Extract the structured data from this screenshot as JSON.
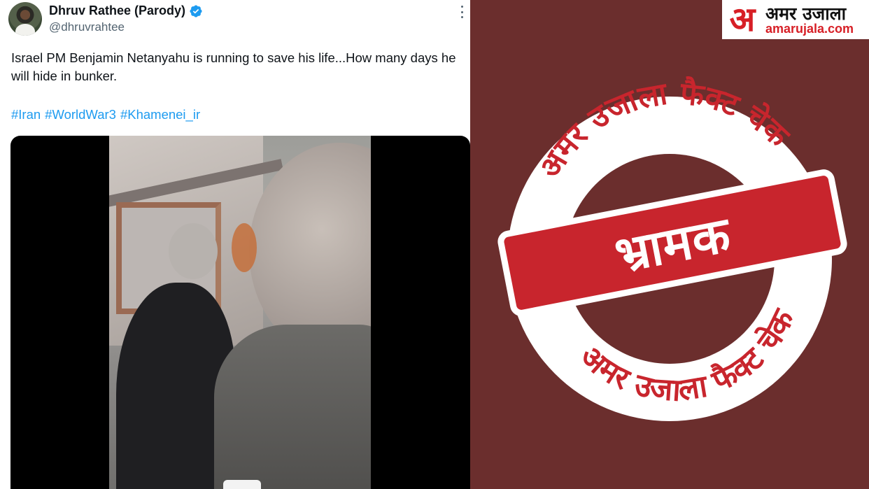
{
  "tweet": {
    "display_name": "Dhruv Rathee (Parody)",
    "handle": "@dhruvrahtee",
    "text": "Israel PM Benjamin Netanyahu is running to save his life...How many days he will hide in bunker.",
    "hashtags": [
      "#Iran",
      "#WorldWar3",
      "#Khamenei_ir"
    ],
    "verified_color": "#1d9bf0",
    "icons": {
      "verified": "verified-badge-icon",
      "more": "more-options-icon"
    }
  },
  "fact_check": {
    "logo_mark": "अ",
    "logo_name": "अमर उजाला",
    "logo_url": "amarujala.com",
    "ring_text_top": "अमर उजाला फैक्ट चेक",
    "ring_text_bottom": "अमर उजाला फैक्ट चेक",
    "verdict": "भ्रामक",
    "colors": {
      "background": "#6b2e2d",
      "accent": "#d71f26",
      "banner": "#c8252d"
    }
  }
}
